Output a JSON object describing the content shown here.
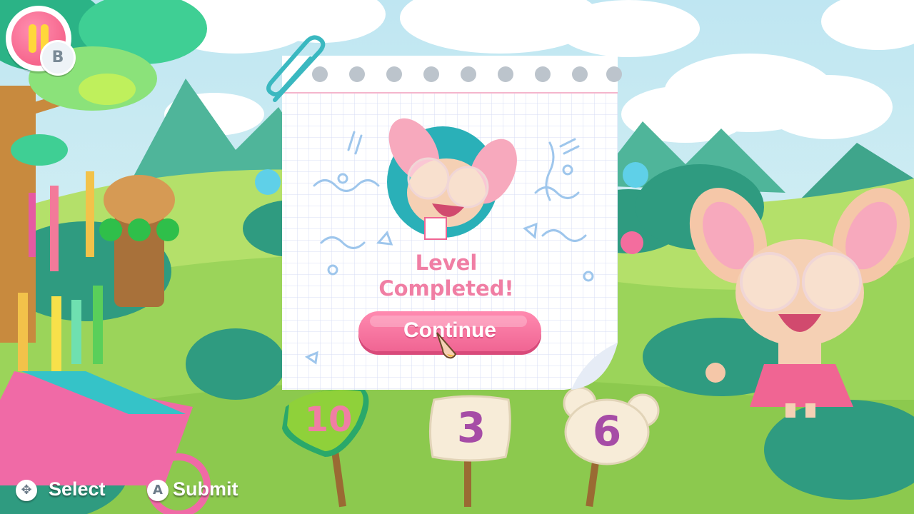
{
  "hud": {
    "pause_icon": "pause-icon",
    "pause_button_hint": "B"
  },
  "dialog": {
    "title_line1": "Level",
    "title_line2": "Completed!",
    "continue_label": "Continue"
  },
  "signs": [
    {
      "value": "10",
      "shape": "triangle",
      "color": "#8fd13a"
    },
    {
      "value": "3",
      "shape": "square",
      "color": "#f7ecd8"
    },
    {
      "value": "6",
      "shape": "mouse-head",
      "color": "#f7ecd8"
    }
  ],
  "controls": [
    {
      "icon": "dpad-icon",
      "label": "Select"
    },
    {
      "icon": "a-button-icon",
      "icon_text": "A",
      "label": "Submit"
    }
  ],
  "colors": {
    "accent_pink": "#f06593",
    "title_pink": "#f07ea4",
    "sky": "#cfeef6",
    "grass": "#9bd45a",
    "number_purple": "#a64ca6"
  }
}
